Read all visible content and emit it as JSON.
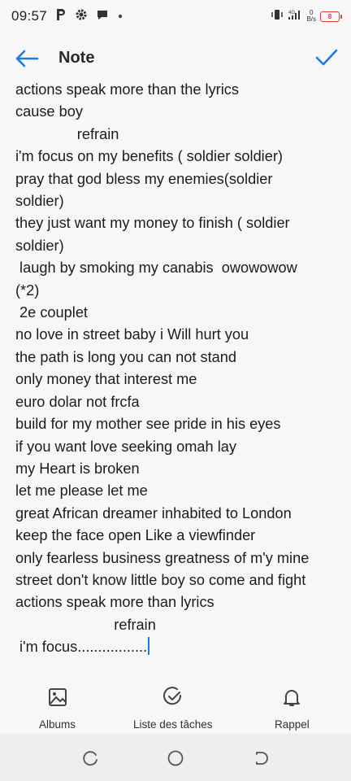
{
  "status_bar": {
    "time": "09:57",
    "signal_label": "4G",
    "net_speed_value": "0",
    "net_speed_unit": "B/s",
    "battery_level": "8",
    "battery_color": "#e53935"
  },
  "header": {
    "title": "Note",
    "accent_color": "#1e7be0"
  },
  "note": {
    "lines": [
      "actions speak more than the lyrics",
      "cause boy",
      "               refrain",
      "i'm focus on my benefits ( soldier soldier)",
      "pray that god bless my enemies(soldier",
      "soldier)",
      "they just want my money to finish ( soldier",
      "soldier)",
      " laugh by smoking my canabis  owowowow",
      "(*2)",
      " 2e couplet",
      "no love in street baby i Will hurt you",
      "the path is long you can not stand",
      "only money that interest me",
      "euro dolar not frcfa",
      "build for my mother see pride in his eyes",
      "if you want love seeking omah lay",
      "my Heart is broken",
      "let me please let me",
      "great African dreamer inhabited to London",
      "keep the face open Like a viewfinder",
      "only fearless business greatness of m'y mine",
      "street don't know little boy so come and fight",
      "actions speak more than lyrics",
      "                        refrain",
      " i'm focus................."
    ]
  },
  "toolbar": {
    "albums_label": "Albums",
    "checklist_label": "Liste des tâches",
    "reminder_label": "Rappel"
  }
}
